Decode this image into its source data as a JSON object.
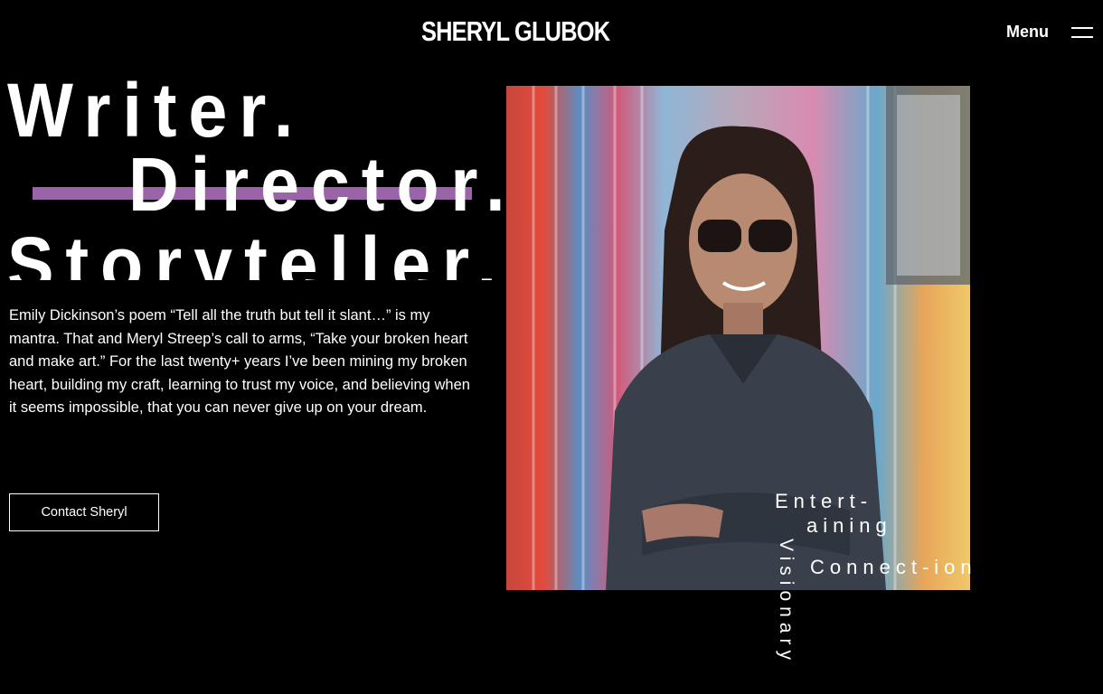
{
  "header": {
    "logo_text": "SHERYL GLUBOK",
    "menu_label": "Menu"
  },
  "hero": {
    "line1": "Writer.",
    "line2": "Director.",
    "line3": "Storyteller.",
    "accent_color": "#9b63a8",
    "bio": "Emily Dickinson’s poem “Tell all the truth but tell it slant…” is my mantra. That and Meryl Streep’s call to arms, “Take your broken heart and make art.” For the last twenty+ years I’ve been mining my broken heart, building my craft, learning to trust my voice, and believing when it seems impossible, that you can never give up on your dream.",
    "cta_label": "Contact Sheryl"
  },
  "photo_tags": {
    "tag1_a": "Entert-",
    "tag1_b": "aining",
    "tag2": "Connect-ion",
    "tag3": "Visionary"
  }
}
